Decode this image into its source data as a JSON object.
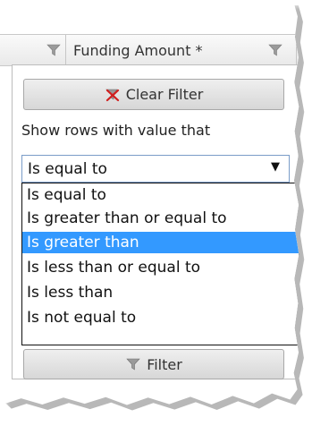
{
  "header": {
    "column_label": "Funding Amount *"
  },
  "filter_panel": {
    "clear_button_label": "Clear Filter",
    "show_rows_label": "Show rows with value that",
    "operator_select": {
      "selected_value": "Is equal to",
      "caret": "▼",
      "options": [
        "Is equal to",
        "Is greater than or equal to",
        "Is greater than",
        "Is less than or equal to",
        "Is less than",
        "Is not equal to"
      ],
      "highlighted_option": "Is greater than"
    },
    "filter_button_label": "Filter"
  },
  "colors": {
    "highlight": "#3399ff",
    "funnel_icon": "#8a8a8a",
    "clear_filter_x": "#d11f1f"
  },
  "icons": [
    "funnel-icon",
    "clear-filter-icon",
    "dropdown-caret-icon"
  ]
}
